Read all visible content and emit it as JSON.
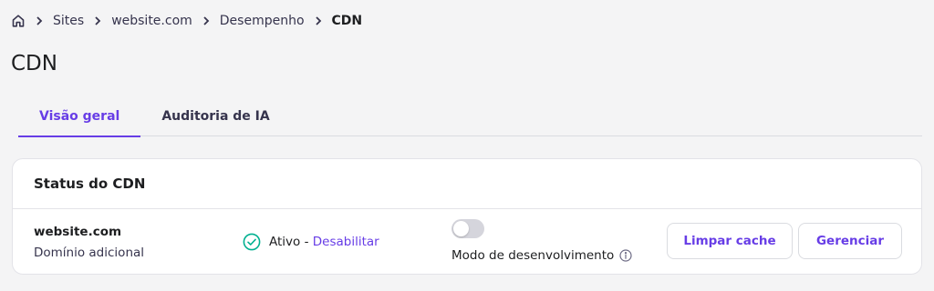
{
  "breadcrumb": {
    "home_icon": "home-icon",
    "items": [
      {
        "label": "Sites"
      },
      {
        "label": "website.com"
      },
      {
        "label": "Desempenho"
      },
      {
        "label": "CDN"
      }
    ]
  },
  "page": {
    "title": "CDN"
  },
  "tabs": [
    {
      "label": "Visão geral",
      "active": true
    },
    {
      "label": "Auditoria de IA",
      "active": false
    }
  ],
  "card": {
    "title": "Status do CDN",
    "domain": {
      "name": "website.com",
      "type": "Domínio adicional"
    },
    "status": {
      "label": "Ativo",
      "separator": " - ",
      "action": "Desabilitar",
      "icon": "check-circle-icon"
    },
    "dev_mode": {
      "label": "Modo de desenvolvimento",
      "enabled": false,
      "icon": "info-icon"
    },
    "buttons": {
      "clear_cache": "Limpar cache",
      "manage": "Gerenciar"
    }
  },
  "colors": {
    "accent": "#673de6",
    "success": "#00b090",
    "background": "#f4f4f5",
    "text": "#1d1e20"
  }
}
